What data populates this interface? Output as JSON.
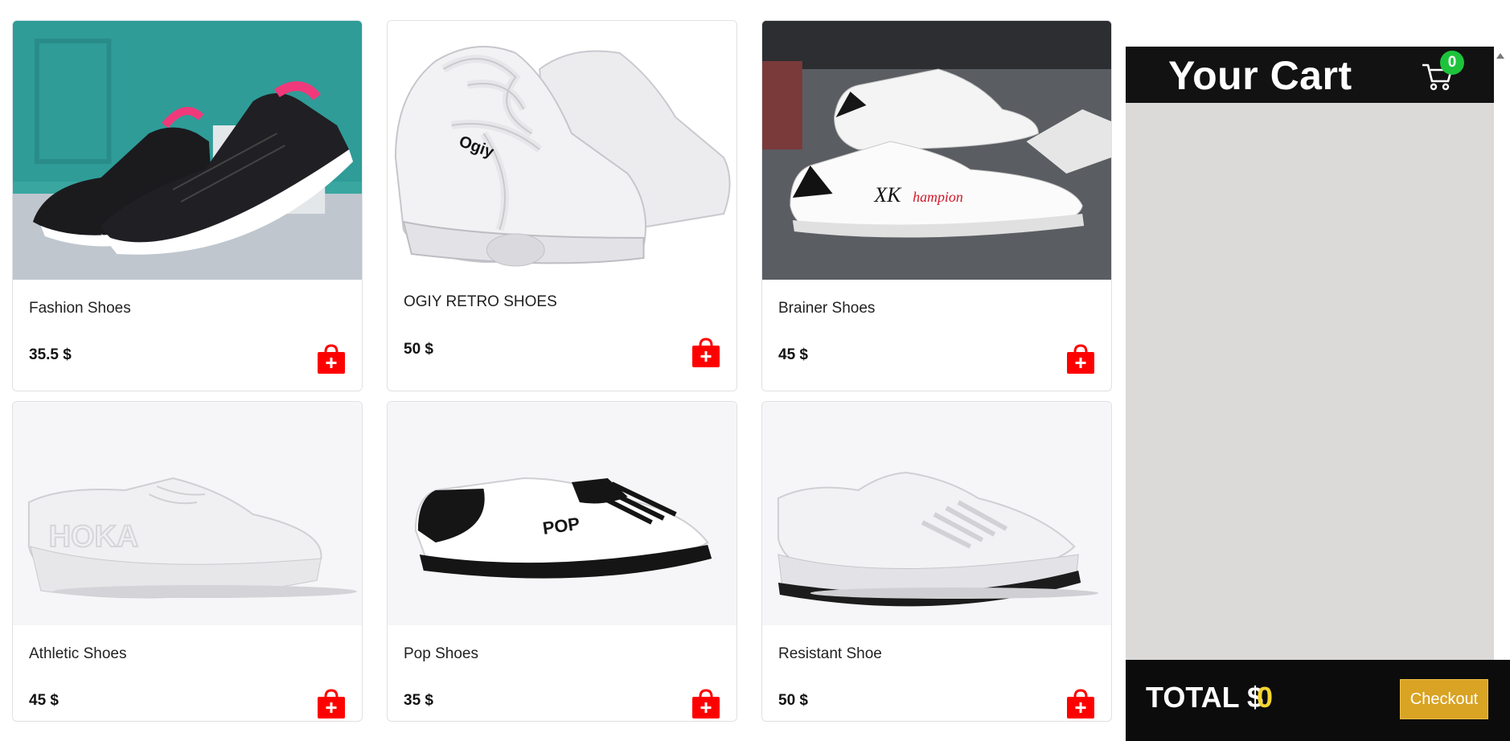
{
  "products": [
    {
      "name": "Fashion Shoes",
      "price": "35.5 $",
      "image": "black-pink-sneaker-photo"
    },
    {
      "name": "OGIY RETRO SHOES",
      "price": "50 $",
      "image": "white-chunky-sneaker-photo"
    },
    {
      "name": "Brainer Shoes",
      "price": "45 $",
      "image": "white-low-top-sneaker-photo"
    },
    {
      "name": "Athletic Shoes",
      "price": "45 $",
      "image": "white-running-shoe-photo"
    },
    {
      "name": "Pop Shoes",
      "price": "35 $",
      "image": "black-white-skate-shoe-photo"
    },
    {
      "name": "Resistant Shoe",
      "price": "50 $",
      "image": "white-trainer-photo"
    }
  ],
  "add_icon": "shopping-bag-plus-icon",
  "cart": {
    "title": "Your Cart",
    "icon": "cart-icon",
    "count": "0",
    "total_label": "TOTAL $",
    "total_value": "0",
    "checkout_label": "Checkout"
  },
  "colors": {
    "add_button": "#ff0000",
    "cart_header": "#121212",
    "cart_body": "#dcd9d9",
    "cart_badge": "#1ec33c",
    "total_value": "#f5d531",
    "checkout": "#d9a323"
  }
}
